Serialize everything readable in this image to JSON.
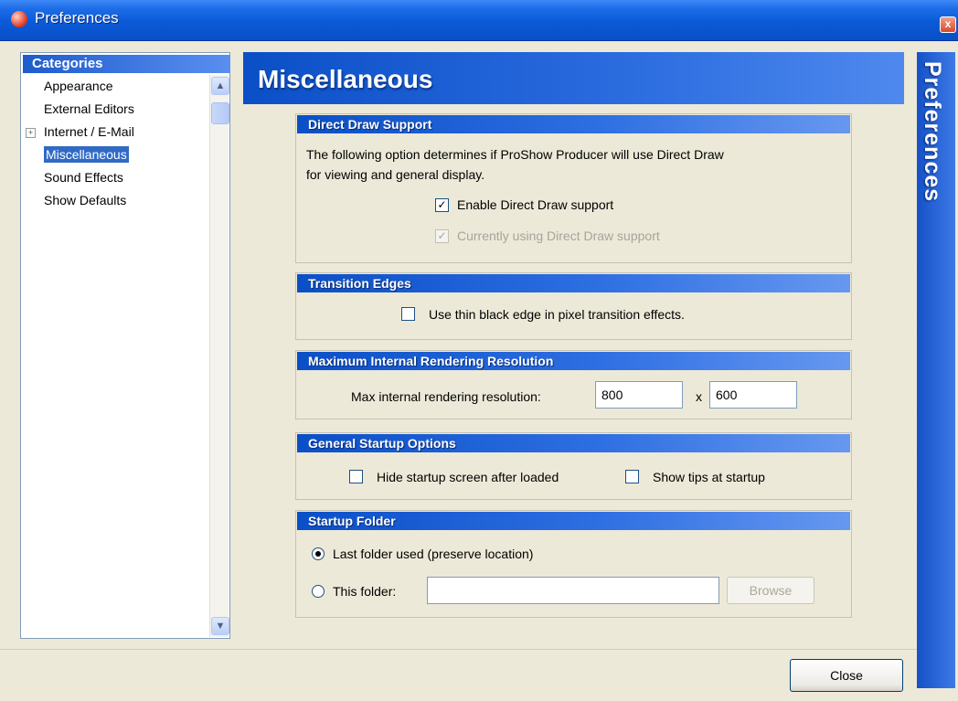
{
  "window": {
    "title": "Preferences",
    "close_glyph": "x"
  },
  "sidebar": {
    "header": "Categories",
    "items": [
      {
        "label": "Appearance",
        "selected": false,
        "expandable": false
      },
      {
        "label": "External Editors",
        "selected": false,
        "expandable": false
      },
      {
        "label": "Internet / E-Mail",
        "selected": false,
        "expandable": true,
        "expander_glyph": "+"
      },
      {
        "label": "Miscellaneous",
        "selected": true,
        "expandable": false
      },
      {
        "label": "Sound Effects",
        "selected": false,
        "expandable": false
      },
      {
        "label": "Show Defaults",
        "selected": false,
        "expandable": false
      }
    ]
  },
  "main": {
    "title": "Miscellaneous",
    "side_banner": "Preferences"
  },
  "direct_draw": {
    "heading": "Direct Draw Support",
    "description_line1": "The following option determines if ProShow Producer will use Direct Draw",
    "description_line2": "for viewing and general display.",
    "enable_label": "Enable Direct Draw support",
    "enable_checked": true,
    "current_label": "Currently using Direct Draw support",
    "current_checked": true
  },
  "transition_edges": {
    "heading": "Transition Edges",
    "label": "Use thin black edge in pixel transition effects.",
    "checked": false
  },
  "max_resolution": {
    "heading": "Maximum Internal Rendering Resolution",
    "label": "Max internal rendering resolution:",
    "width": "800",
    "separator": "x",
    "height": "600"
  },
  "startup_options": {
    "heading": "General Startup Options",
    "hide_label": "Hide startup screen after loaded",
    "hide_checked": false,
    "tips_label": "Show tips at startup",
    "tips_checked": false
  },
  "startup_folder": {
    "heading": "Startup Folder",
    "last_label": "Last folder used (preserve location)",
    "this_label": "This folder:",
    "selected": "last",
    "folder_value": "",
    "browse_label": "Browse"
  },
  "footer": {
    "close_label": "Close"
  },
  "colors": {
    "accent": "#0a5ad8",
    "selection": "#316ac5",
    "face": "#ece9d8"
  }
}
